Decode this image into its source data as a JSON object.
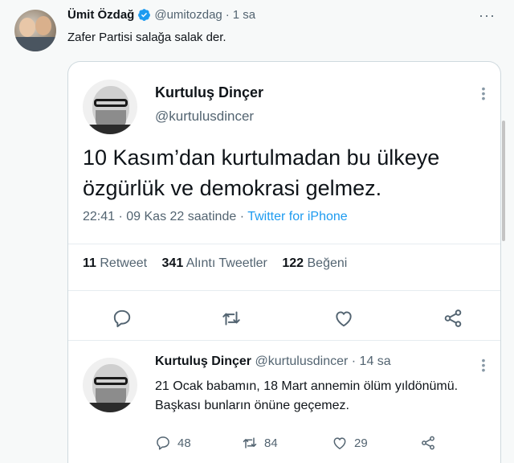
{
  "outer_tweet": {
    "author_name": "Ümit Özdağ",
    "handle": "@umitozdag",
    "separator": "·",
    "time": "1 sa",
    "more": "···",
    "text": "Zafer Partisi salağa salak der."
  },
  "quoted_tweet": {
    "author_name": "Kurtuluş Dinçer",
    "handle": "@kurtulusdincer",
    "text": "10 Kasım’dan kurtulmadan bu ülkeye özgürlük ve demokrasi gelmez.",
    "timestamp": "22:41 · 09 Kas 22 saatinde · ",
    "source": "Twitter for iPhone",
    "stats": {
      "retweets_count": "11",
      "retweets_label": "Retweet",
      "quotes_count": "341",
      "quotes_label": "Alıntı Tweetler",
      "likes_count": "122",
      "likes_label": "Beğeni"
    }
  },
  "reply_tweet": {
    "author_name": "Kurtuluş Dinçer",
    "handle": "@kurtulusdincer",
    "separator": "·",
    "time": "14 sa",
    "text": "21 Ocak babamın, 18 Mart annemin ölüm yıldönümü. Başkası bunların önüne geçemez.",
    "replies": "48",
    "retweets": "84",
    "likes": "29"
  },
  "colors": {
    "accent": "#1d9bf0",
    "text_primary": "#0f1419",
    "text_secondary": "#536471",
    "border": "#cfd9de"
  },
  "icons": [
    "verified-badge-icon",
    "more-icon",
    "reply-icon",
    "retweet-icon",
    "like-icon",
    "share-icon"
  ]
}
